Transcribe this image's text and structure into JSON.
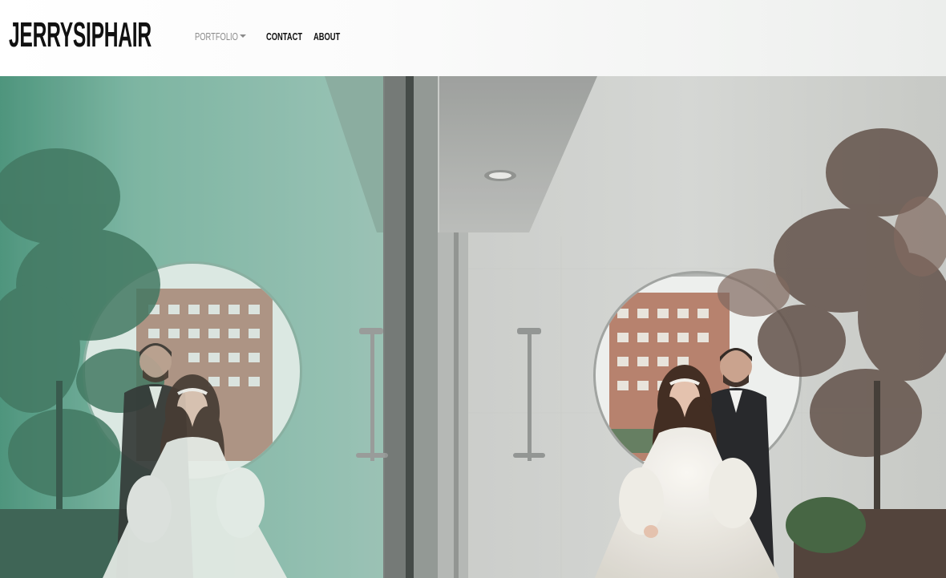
{
  "site": {
    "brand": "JERRYSIPHAIR"
  },
  "nav": {
    "items": [
      {
        "label": "PORTFOLIO",
        "has_dropdown": true
      },
      {
        "label": "CONTACT"
      },
      {
        "label": "ABOUT"
      }
    ]
  },
  "hero": {
    "alt_subject": "Bride and groom standing beside a round mirror and outdoor shower, reflected in a glass panel",
    "colors": {
      "wall": "#cfd2cf",
      "reflection_tint": "#6fb39a",
      "gown": "#ece9e2",
      "suit": "#1e1f22",
      "brick": "#b8806c",
      "foliage": "#5b4a40"
    }
  }
}
